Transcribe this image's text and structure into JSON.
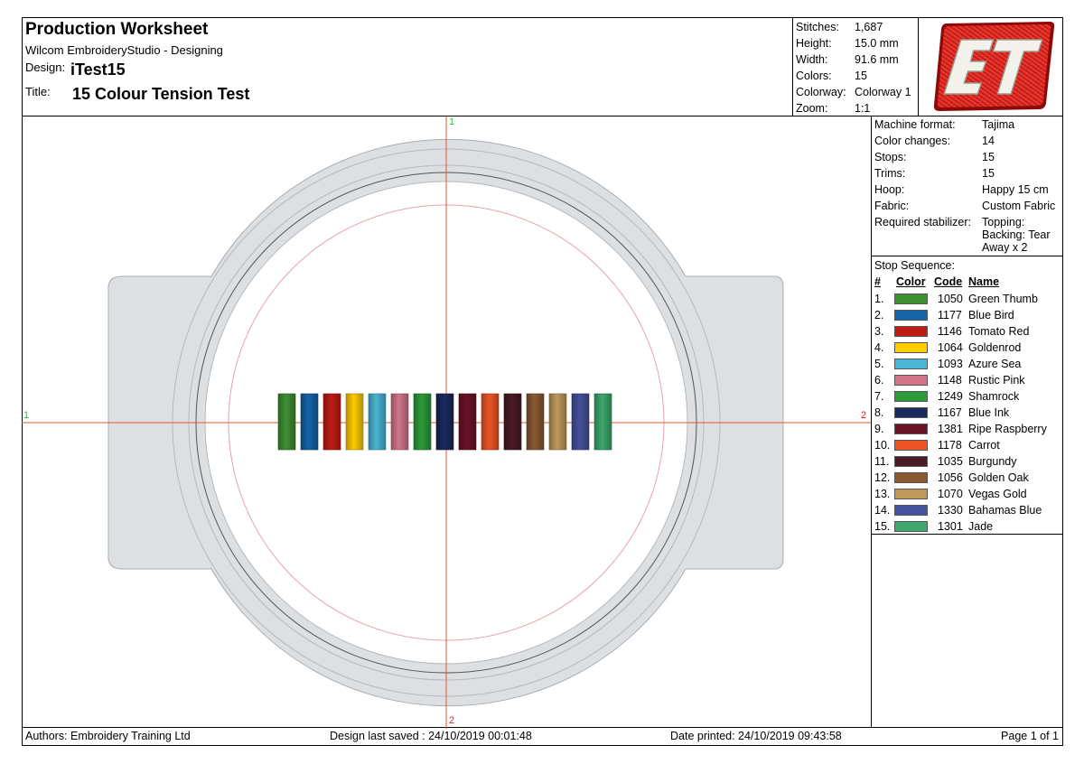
{
  "header": {
    "title": "Production Worksheet",
    "software": "Wilcom EmbroideryStudio - Designing",
    "design_label": "Design:",
    "design_value": "iTest15",
    "title_label": "Title:",
    "title_value": "15 Colour Tension Test"
  },
  "stats": [
    {
      "label": "Stitches:",
      "value": "1,687"
    },
    {
      "label": "Height:",
      "value": "15.0 mm"
    },
    {
      "label": "Width:",
      "value": "91.6 mm"
    },
    {
      "label": "Colors:",
      "value": "15"
    },
    {
      "label": "Colorway:",
      "value": "Colorway 1"
    },
    {
      "label": "Zoom:",
      "value": "1:1"
    }
  ],
  "logo": {
    "text": "ET",
    "color": "#d81e1e"
  },
  "machine": [
    {
      "label": "Machine format:",
      "value": "Tajima"
    },
    {
      "label": "Color changes:",
      "value": "14"
    },
    {
      "label": "Stops:",
      "value": "15"
    },
    {
      "label": "Trims:",
      "value": "15"
    },
    {
      "label": "Hoop:",
      "value": "Happy 15 cm"
    },
    {
      "label": "Fabric:",
      "value": "Custom Fabric"
    }
  ],
  "stabilizer": {
    "label": "Required stabilizer:",
    "lines": [
      "Topping:",
      "Backing: Tear",
      "Away x 2"
    ]
  },
  "stop_sequence": {
    "title": "Stop Sequence:",
    "headers": {
      "num": "#",
      "color": "Color",
      "code": "Code",
      "name": "Name"
    },
    "items": [
      {
        "num": "1.",
        "color": "#3f8f33",
        "code": "1050",
        "name": "Green Thumb"
      },
      {
        "num": "2.",
        "color": "#1464a8",
        "code": "1177",
        "name": "Blue Bird"
      },
      {
        "num": "3.",
        "color": "#c01c16",
        "code": "1146",
        "name": "Tomato Red"
      },
      {
        "num": "4.",
        "color": "#ffcc00",
        "code": "1064",
        "name": "Goldenrod"
      },
      {
        "num": "5.",
        "color": "#4bb6d5",
        "code": "1093",
        "name": "Azure Sea"
      },
      {
        "num": "6.",
        "color": "#d3758a",
        "code": "1148",
        "name": "Rustic Pink"
      },
      {
        "num": "7.",
        "color": "#2e9b3a",
        "code": "1249",
        "name": "Shamrock"
      },
      {
        "num": "8.",
        "color": "#1a2a5c",
        "code": "1167",
        "name": "Blue Ink"
      },
      {
        "num": "9.",
        "color": "#6a1325",
        "code": "1381",
        "name": "Ripe Raspberry"
      },
      {
        "num": "10.",
        "color": "#ee5524",
        "code": "1178",
        "name": "Carrot"
      },
      {
        "num": "11.",
        "color": "#4a1a26",
        "code": "1035",
        "name": "Burgundy"
      },
      {
        "num": "12.",
        "color": "#8b5a32",
        "code": "1056",
        "name": "Golden Oak"
      },
      {
        "num": "13.",
        "color": "#c09a5c",
        "code": "1070",
        "name": "Vegas Gold"
      },
      {
        "num": "14.",
        "color": "#44529c",
        "code": "1330",
        "name": "Bahamas Blue"
      },
      {
        "num": "15.",
        "color": "#3fa86e",
        "code": "1301",
        "name": "Jade"
      }
    ]
  },
  "axes": {
    "top": "1",
    "left": "1",
    "right": "2",
    "bottom": "2",
    "top_color": "#22cc22",
    "left_color": "#22cc22",
    "right_color": "#dd2222",
    "bottom_color": "#dd2222",
    "line_color": "#e8552a"
  },
  "footer": {
    "authors": "Authors: Embroidery Training Ltd",
    "saved": "Design last saved : 24/10/2019 00:01:48",
    "printed": "Date printed: 24/10/2019 09:43:58",
    "page": "Page 1 of 1"
  }
}
